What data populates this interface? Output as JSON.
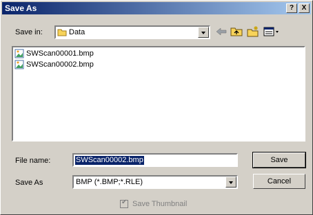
{
  "window": {
    "title": "Save As"
  },
  "title_buttons": {
    "help": "?",
    "close": "X"
  },
  "save_in": {
    "label": "Save in:",
    "value": "Data"
  },
  "files": [
    {
      "name": "SWScan00001.bmp",
      "icon": "bitmap-file-icon"
    },
    {
      "name": "SWScan00002.bmp",
      "icon": "bitmap-file-icon"
    }
  ],
  "file_name": {
    "label": "File name:",
    "value": "SWScan00002.bmp"
  },
  "save_as": {
    "label": "Save As",
    "value": "BMP (*.BMP;*.RLE)"
  },
  "buttons": {
    "save": "Save",
    "cancel": "Cancel"
  },
  "thumbnail": {
    "label": "Save Thumbnail",
    "checked": true,
    "enabled": false
  },
  "colors": {
    "titlebar": "#0a246a",
    "face": "#d4d0c8",
    "selection": "#0a246a"
  }
}
